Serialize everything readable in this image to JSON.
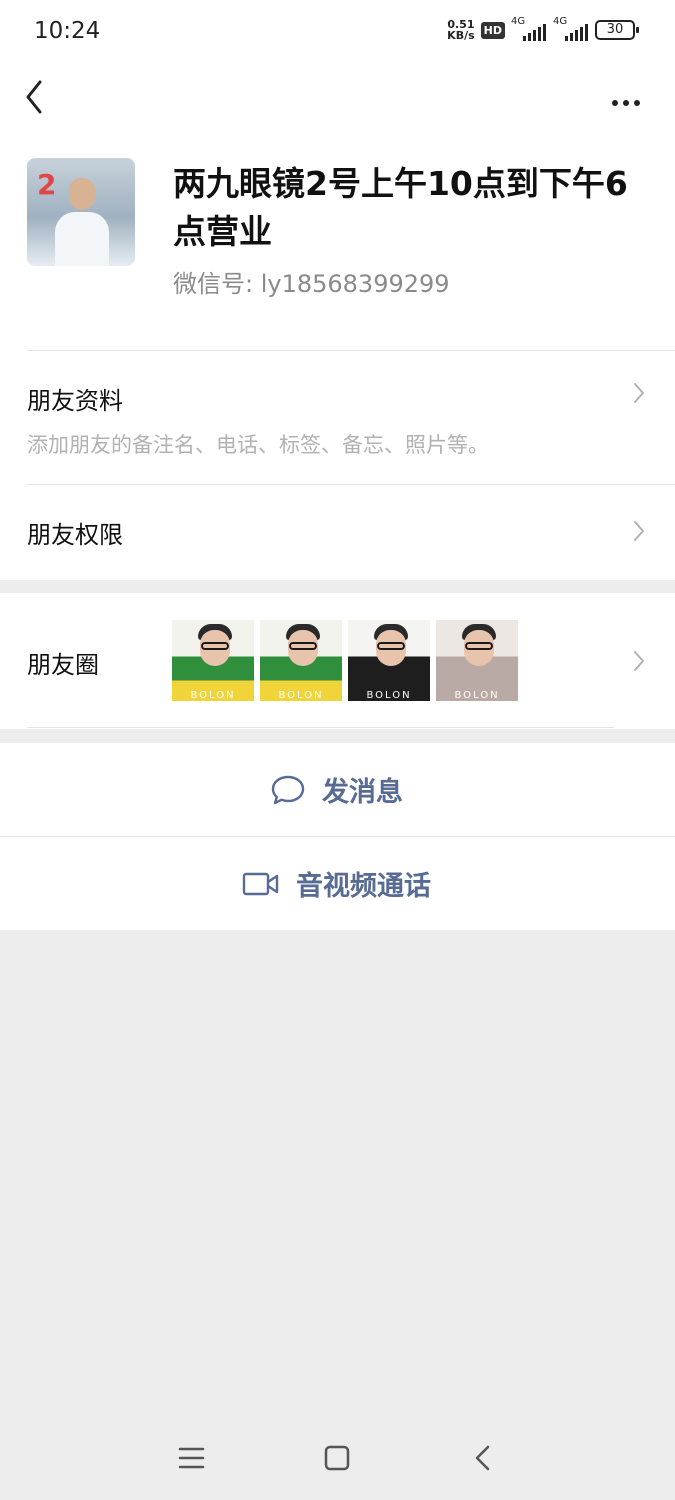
{
  "status_bar": {
    "time": "10:24",
    "speed_value": "0.51",
    "speed_unit": "KB/s",
    "hd": "HD",
    "network1": "4G",
    "network2": "4G",
    "battery": "30"
  },
  "nav": {
    "back_icon": "chevron-left-icon",
    "more_icon": "more-horizontal-icon"
  },
  "profile": {
    "name": "两九眼镜2号上午10点到下午6点营业",
    "wechat_id": "微信号: ly18568399299"
  },
  "friend_info": {
    "title": "朋友资料",
    "subtitle": "添加朋友的备注名、电话、标签、备忘、照片等。"
  },
  "friend_permission": {
    "title": "朋友权限"
  },
  "moments": {
    "title": "朋友圈",
    "thumbnails": [
      {
        "brand": "BOLON"
      },
      {
        "brand": "BOLON"
      },
      {
        "brand": "BOLON"
      },
      {
        "brand": "BOLON"
      }
    ]
  },
  "actions": {
    "message": "发消息",
    "video_call": "音视频通话"
  },
  "colors": {
    "accent": "#576b95",
    "background": "#ededed"
  }
}
